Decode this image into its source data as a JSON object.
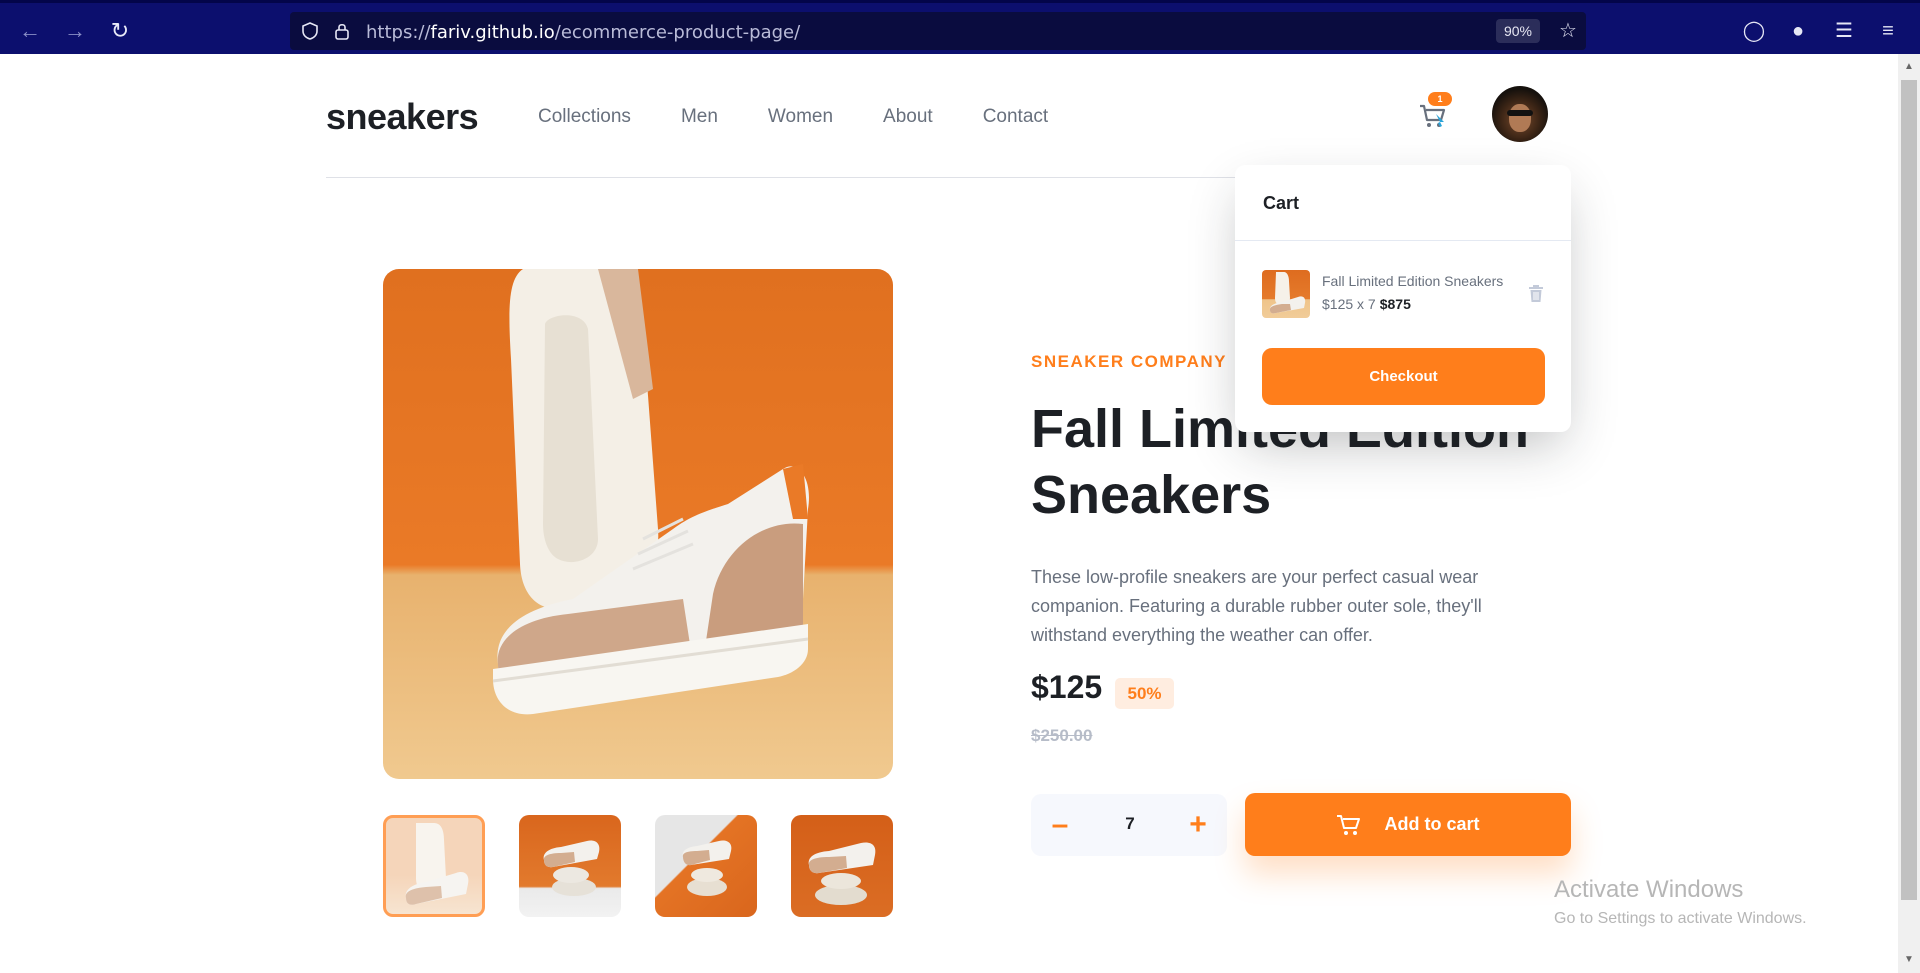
{
  "browser": {
    "url_prefix": "https://",
    "url_domain": "fariv.github.io",
    "url_path": "/ecommerce-product-page/",
    "zoom": "90%"
  },
  "header": {
    "logo": "sneakers",
    "nav": [
      "Collections",
      "Men",
      "Women",
      "About",
      "Contact"
    ],
    "cart_count": "1"
  },
  "product": {
    "company": "SNEAKER COMPANY",
    "title": "Fall Limited Edition Sneakers",
    "description": "These low-profile sneakers are your perfect casual wear companion. Featuring a durable rubber outer sole, they'll withstand everything the weather can offer.",
    "price": "$125",
    "discount": "50%",
    "original_price": "$250.00",
    "quantity": "7",
    "add_to_cart_label": "Add to cart",
    "thumbnail_count": 4,
    "active_thumbnail": 1
  },
  "cart": {
    "title": "Cart",
    "item_name": "Fall Limited Edition Sneakers",
    "item_calc": "$125 x 7",
    "item_total": "$875",
    "checkout_label": "Checkout"
  },
  "watermark": {
    "title": "Activate Windows",
    "subtitle": "Go to Settings to activate Windows."
  },
  "colors": {
    "accent": "#ff7e1b",
    "pale_orange": "#ffede0",
    "text_dark": "#1d2025",
    "text_gray": "#68707d",
    "browser_bar": "#0c0f6e"
  }
}
